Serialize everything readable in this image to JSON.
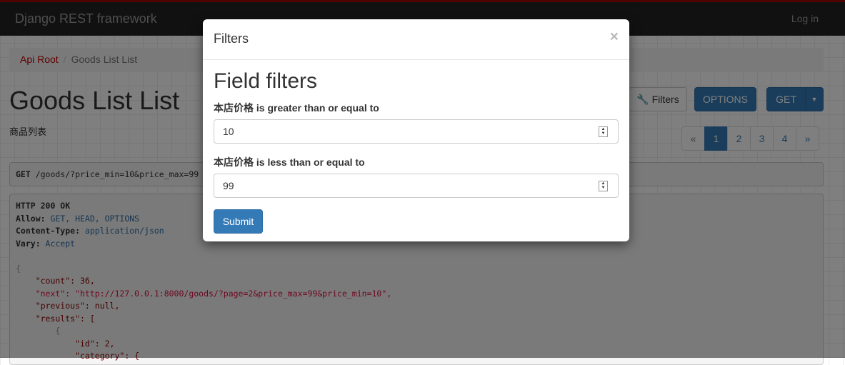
{
  "navbar": {
    "brand": "Django REST framework",
    "login": "Log in"
  },
  "breadcrumb": [
    "Api Root",
    "Goods List List"
  ],
  "page": {
    "title": "Goods List List",
    "description": "商品列表"
  },
  "toolbar": {
    "filters": "Filters",
    "options": "OPTIONS",
    "get": "GET"
  },
  "pagination": [
    "«",
    "1",
    "2",
    "3",
    "4",
    "»"
  ],
  "request": {
    "method": "GET",
    "path": " /goods/?price_min=10&price_max=99"
  },
  "response": {
    "status": "HTTP 200 OK",
    "allow_key": "Allow:",
    "allow": " GET, HEAD, OPTIONS",
    "ct_key": "Content-Type:",
    "ct": " application/json",
    "vary_key": "Vary:",
    "vary": " Accept",
    "lines": [
      "{",
      "    \"count\": 36,",
      "    \"next\": \"http://127.0.0.1:8000/goods/?page=2&price_max=99&price_min=10\",",
      "    \"previous\": null,",
      "    \"results\": [",
      "        {",
      "            \"id\": 2,",
      "            \"category\": {"
    ]
  },
  "modal": {
    "title": "Filters",
    "close": "×",
    "heading": "Field filters",
    "fields": [
      {
        "label": "本店价格 is greater than or equal to",
        "value": "10"
      },
      {
        "label": "本店价格 is less than or equal to",
        "value": "99"
      }
    ],
    "submit": "Submit"
  }
}
